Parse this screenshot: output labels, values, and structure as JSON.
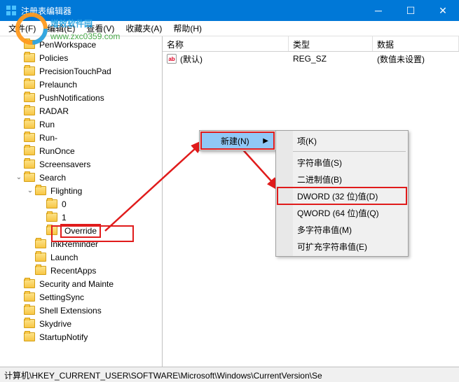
{
  "titlebar": {
    "title": "注册表编辑器"
  },
  "menubar": {
    "file": "文件(F)",
    "edit": "编辑(E)",
    "view": "查看(V)",
    "favorites": "收藏夹(A)",
    "help": "帮助(H)"
  },
  "tree": [
    {
      "indent": 3,
      "caret": "",
      "label": "PenWorkspace"
    },
    {
      "indent": 3,
      "caret": "",
      "label": "Policies"
    },
    {
      "indent": 3,
      "caret": "",
      "label": "PrecisionTouchPad"
    },
    {
      "indent": 3,
      "caret": "",
      "label": "Prelaunch"
    },
    {
      "indent": 3,
      "caret": "",
      "label": "PushNotifications"
    },
    {
      "indent": 3,
      "caret": "",
      "label": "RADAR"
    },
    {
      "indent": 3,
      "caret": "",
      "label": "Run"
    },
    {
      "indent": 3,
      "caret": "",
      "label": "Run-"
    },
    {
      "indent": 3,
      "caret": "",
      "label": "RunOnce"
    },
    {
      "indent": 3,
      "caret": "",
      "label": "Screensavers"
    },
    {
      "indent": 3,
      "caret": "v",
      "label": "Search"
    },
    {
      "indent": 4,
      "caret": "v",
      "label": "Flighting"
    },
    {
      "indent": 5,
      "caret": "",
      "label": "0"
    },
    {
      "indent": 5,
      "caret": "",
      "label": "1"
    },
    {
      "indent": 5,
      "caret": "",
      "label": "Override",
      "selected": true
    },
    {
      "indent": 4,
      "caret": "",
      "label": "InkReminder"
    },
    {
      "indent": 4,
      "caret": "",
      "label": "Launch"
    },
    {
      "indent": 4,
      "caret": "",
      "label": "RecentApps"
    },
    {
      "indent": 3,
      "caret": "",
      "label": "Security and Mainte"
    },
    {
      "indent": 3,
      "caret": "",
      "label": "SettingSync"
    },
    {
      "indent": 3,
      "caret": "",
      "label": "Shell Extensions"
    },
    {
      "indent": 3,
      "caret": "",
      "label": "Skydrive"
    },
    {
      "indent": 3,
      "caret": "",
      "label": "StartupNotify"
    }
  ],
  "list": {
    "headers": {
      "name": "名称",
      "type": "类型",
      "data": "数据"
    },
    "rows": [
      {
        "icon": "ab",
        "name": "(默认)",
        "type": "REG_SZ",
        "data": "(数值未设置)"
      }
    ]
  },
  "context1": {
    "new": "新建(N)"
  },
  "context2": {
    "key": "项(K)",
    "string": "字符串值(S)",
    "binary": "二进制值(B)",
    "dword": "DWORD (32 位)值(D)",
    "qword": "QWORD (64 位)值(Q)",
    "multi": "多字符串值(M)",
    "expand": "可扩充字符串值(E)"
  },
  "statusbar": {
    "path": "计算机\\HKEY_CURRENT_USER\\SOFTWARE\\Microsoft\\Windows\\CurrentVersion\\Se"
  },
  "watermark": {
    "line1": "增效软件园",
    "line2": "www.zxc0359.com"
  }
}
